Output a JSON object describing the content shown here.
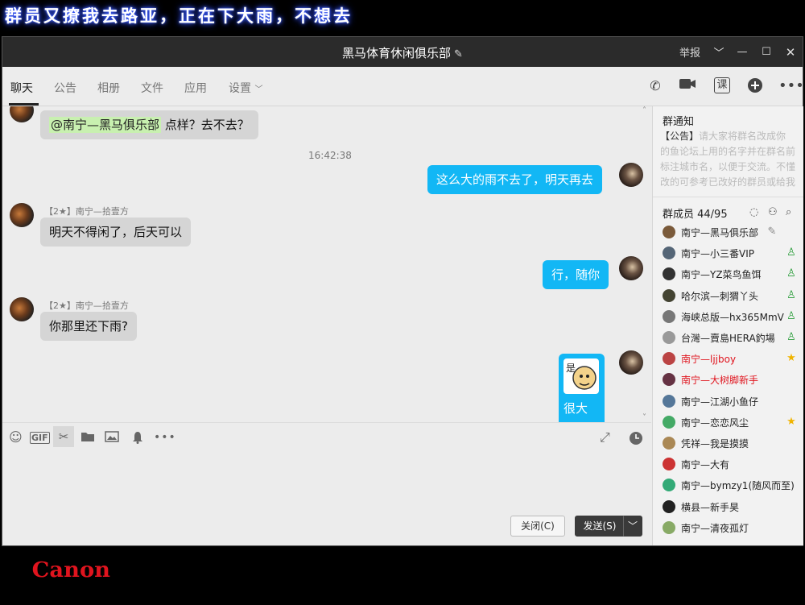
{
  "caption": "群员又撩我去路亚，正在下大雨，不想去",
  "watermark": "Canon",
  "window": {
    "title": "黑马体育休闲俱乐部",
    "edit_icon": "edit-icon",
    "report_label": "举报",
    "controls": [
      "chevron-down-icon",
      "minimize-icon",
      "maximize-icon",
      "close-icon"
    ]
  },
  "tabs": [
    {
      "label": "聊天",
      "active": true
    },
    {
      "label": "公告",
      "active": false
    },
    {
      "label": "相册",
      "active": false
    },
    {
      "label": "文件",
      "active": false
    },
    {
      "label": "应用",
      "active": false
    },
    {
      "label": "设置",
      "active": false
    }
  ],
  "toolbar_right": {
    "phone_icon": "phone-icon",
    "video_icon": "video-icon",
    "lesson_label": "课",
    "add_icon": "plus-circle-icon",
    "more_icon": "more-icon"
  },
  "messages": [
    {
      "from": "other",
      "mention": "@南宁—黑马俱乐部",
      "text": " 点样？去不去？"
    },
    {
      "type": "time",
      "text": "16:42:38"
    },
    {
      "from": "me",
      "text": "这么大的雨不去了，明天再去"
    },
    {
      "from": "other",
      "sender": "【2★】南宁—拾壹方",
      "text": "明天不得闲了，后天可以"
    },
    {
      "from": "me",
      "text": "行，随你"
    },
    {
      "from": "other",
      "sender": "【2★】南宁—拾壹方",
      "text": "你那里还下雨?"
    },
    {
      "from": "me",
      "text": "很大",
      "sticker_text": "是"
    }
  ],
  "input_toolbar": [
    "smile-icon",
    "gif-icon",
    "scissors-icon",
    "folder-icon",
    "image-icon",
    "bell-icon",
    "more-icon"
  ],
  "buttons": {
    "close": "关闭(C)",
    "send": "发送(S)"
  },
  "sidebar": {
    "notice_title": "群通知",
    "notice_tag": "【公告】",
    "notice_text": "请大家将群名改成你的鱼论坛上用的名字并在群名前标注城市名，以便于交流。不懂改的可参考已改好的群员或给我留...",
    "members_title": "群成员 44/95",
    "members": [
      {
        "name": "南宁—黑马俱乐部",
        "color": "#222",
        "badge": "owner"
      },
      {
        "name": "南宁—小三番VIP",
        "color": "#222",
        "badge": "admin"
      },
      {
        "name": "南宁—YZ菜鸟鱼饵",
        "color": "#222",
        "badge": "admin"
      },
      {
        "name": "哈尔滨—刺猬丫头",
        "color": "#222",
        "badge": "admin"
      },
      {
        "name": "海峡总版—hx365MmV",
        "color": "#222",
        "badge": "admin"
      },
      {
        "name": "台灣—賣島HERA釣場",
        "color": "#222",
        "badge": "admin"
      },
      {
        "name": "南宁—ljjboy",
        "color": "#e0141e",
        "badge": "star"
      },
      {
        "name": "南宁—大树脚新手",
        "color": "#e0141e",
        "badge": ""
      },
      {
        "name": "南宁—江湖小鱼仔",
        "color": "#222",
        "badge": ""
      },
      {
        "name": "南宁—恋恋风尘",
        "color": "#222",
        "badge": "star"
      },
      {
        "name": "凭祥—我是摸摸",
        "color": "#222",
        "badge": ""
      },
      {
        "name": "南宁—大有",
        "color": "#222",
        "badge": ""
      },
      {
        "name": "南宁—bymzy1(随风而至)",
        "color": "#222",
        "badge": ""
      },
      {
        "name": "横县—新手昊",
        "color": "#222",
        "badge": ""
      },
      {
        "name": "南宁—清夜孤灯",
        "color": "#222",
        "badge": ""
      }
    ]
  }
}
